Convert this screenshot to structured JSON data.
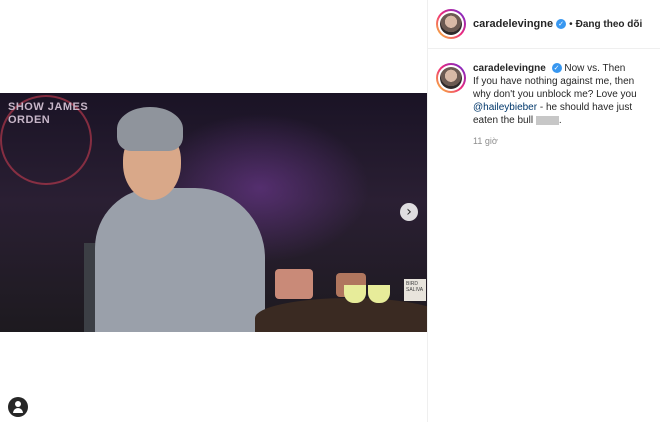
{
  "header": {
    "username": "caradelevingne",
    "separator": "•",
    "follow_label": "Đang theo dõi"
  },
  "caption": {
    "username": "caradelevingne",
    "text_line1": "Now vs. Then",
    "text_body": "If you have nothing against me, then why don't you unblock me? Love you ",
    "mention": "@haileybieber",
    "text_after": " - he should have just eaten the bull",
    "text_end": ".",
    "time": "11 giờ"
  },
  "media": {
    "show_logo_text": "SHOW JAMES ORDEN",
    "card_text": "BIRD SALIVA"
  },
  "icons": {
    "verified": "verified-badge-icon",
    "next": "chevron-right-icon",
    "user_tag": "user-tag-icon"
  },
  "colors": {
    "verified": "#3897f0",
    "mention": "#00376b",
    "muted": "#8e8e8e"
  }
}
